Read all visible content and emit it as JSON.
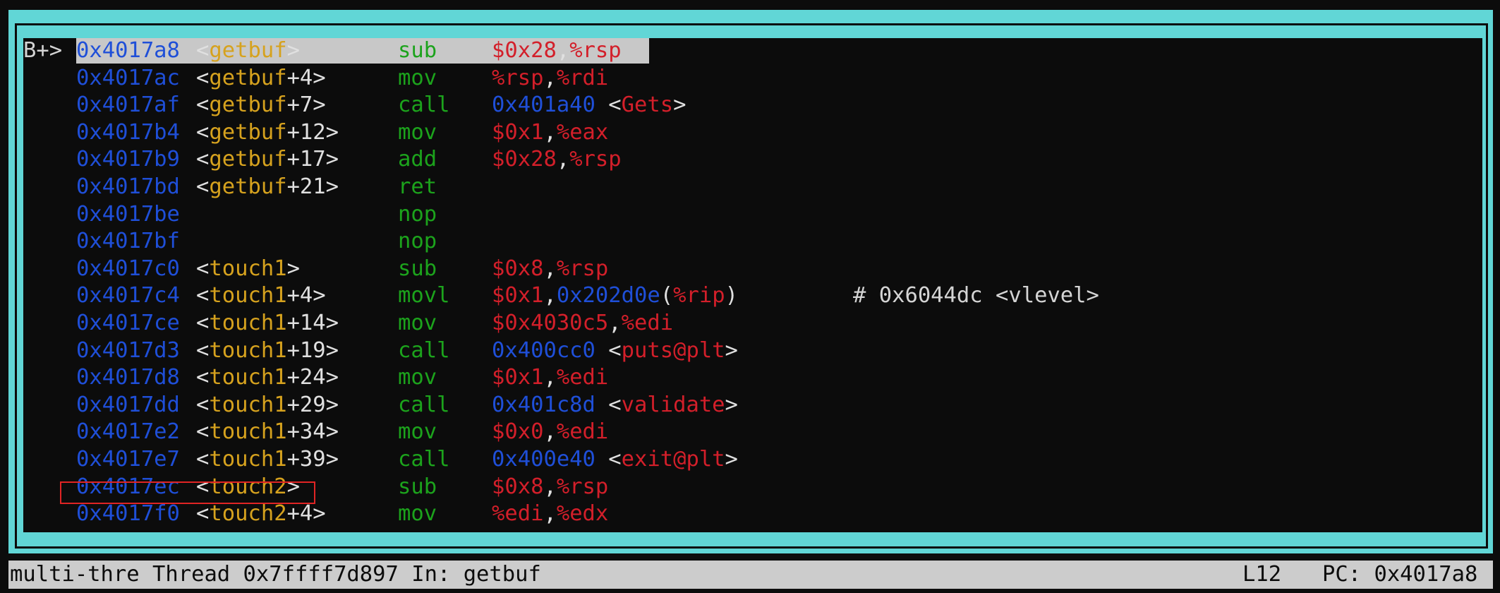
{
  "asm_panel": {
    "rows": [
      {
        "marker": "B+>",
        "addr": "0x4017a8",
        "sym_fn": "getbuf",
        "sym_off": "",
        "mnem": "sub",
        "ops": [
          [
            "$0x28",
            "reg"
          ],
          [
            ",",
            "pun"
          ],
          [
            "%rsp",
            "reg"
          ]
        ],
        "comment": "",
        "current": true
      },
      {
        "marker": "",
        "addr": "0x4017ac",
        "sym_fn": "getbuf",
        "sym_off": "+4",
        "mnem": "mov",
        "ops": [
          [
            "%rsp",
            "reg"
          ],
          [
            ",",
            "pun"
          ],
          [
            "%rdi",
            "reg"
          ]
        ],
        "comment": ""
      },
      {
        "marker": "",
        "addr": "0x4017af",
        "sym_fn": "getbuf",
        "sym_off": "+7",
        "mnem": "call",
        "ops": [
          [
            "0x401a40",
            "hex"
          ],
          [
            " <",
            "pun"
          ],
          [
            "Gets",
            "reg"
          ],
          [
            ">",
            "pun"
          ]
        ],
        "comment": ""
      },
      {
        "marker": "",
        "addr": "0x4017b4",
        "sym_fn": "getbuf",
        "sym_off": "+12",
        "mnem": "mov",
        "ops": [
          [
            "$0x1",
            "reg"
          ],
          [
            ",",
            "pun"
          ],
          [
            "%eax",
            "reg"
          ]
        ],
        "comment": ""
      },
      {
        "marker": "",
        "addr": "0x4017b9",
        "sym_fn": "getbuf",
        "sym_off": "+17",
        "mnem": "add",
        "ops": [
          [
            "$0x28",
            "reg"
          ],
          [
            ",",
            "pun"
          ],
          [
            "%rsp",
            "reg"
          ]
        ],
        "comment": ""
      },
      {
        "marker": "",
        "addr": "0x4017bd",
        "sym_fn": "getbuf",
        "sym_off": "+21",
        "mnem": "ret",
        "ops": [],
        "comment": ""
      },
      {
        "marker": "",
        "addr": "0x4017be",
        "sym_fn": "",
        "sym_off": "",
        "mnem": "nop",
        "ops": [],
        "comment": ""
      },
      {
        "marker": "",
        "addr": "0x4017bf",
        "sym_fn": "",
        "sym_off": "",
        "mnem": "nop",
        "ops": [],
        "comment": ""
      },
      {
        "marker": "",
        "addr": "0x4017c0",
        "sym_fn": "touch1",
        "sym_off": "",
        "mnem": "sub",
        "ops": [
          [
            "$0x8",
            "reg"
          ],
          [
            ",",
            "pun"
          ],
          [
            "%rsp",
            "reg"
          ]
        ],
        "comment": ""
      },
      {
        "marker": "",
        "addr": "0x4017c4",
        "sym_fn": "touch1",
        "sym_off": "+4",
        "mnem": "movl",
        "ops": [
          [
            "$0x1",
            "reg"
          ],
          [
            ",",
            "pun"
          ],
          [
            "0x202d0e",
            "hex"
          ],
          [
            "(",
            "pun"
          ],
          [
            "%rip",
            "reg"
          ],
          [
            ")",
            "pun"
          ]
        ],
        "comment": "# 0x6044dc <vlevel>"
      },
      {
        "marker": "",
        "addr": "0x4017ce",
        "sym_fn": "touch1",
        "sym_off": "+14",
        "mnem": "mov",
        "ops": [
          [
            "$0x4030c5",
            "reg"
          ],
          [
            ",",
            "pun"
          ],
          [
            "%edi",
            "reg"
          ]
        ],
        "comment": ""
      },
      {
        "marker": "",
        "addr": "0x4017d3",
        "sym_fn": "touch1",
        "sym_off": "+19",
        "mnem": "call",
        "ops": [
          [
            "0x400cc0",
            "hex"
          ],
          [
            " <",
            "pun"
          ],
          [
            "puts@plt",
            "reg"
          ],
          [
            ">",
            "pun"
          ]
        ],
        "comment": ""
      },
      {
        "marker": "",
        "addr": "0x4017d8",
        "sym_fn": "touch1",
        "sym_off": "+24",
        "mnem": "mov",
        "ops": [
          [
            "$0x1",
            "reg"
          ],
          [
            ",",
            "pun"
          ],
          [
            "%edi",
            "reg"
          ]
        ],
        "comment": ""
      },
      {
        "marker": "",
        "addr": "0x4017dd",
        "sym_fn": "touch1",
        "sym_off": "+29",
        "mnem": "call",
        "ops": [
          [
            "0x401c8d",
            "hex"
          ],
          [
            " <",
            "pun"
          ],
          [
            "validate",
            "reg"
          ],
          [
            ">",
            "pun"
          ]
        ],
        "comment": ""
      },
      {
        "marker": "",
        "addr": "0x4017e2",
        "sym_fn": "touch1",
        "sym_off": "+34",
        "mnem": "mov",
        "ops": [
          [
            "$0x0",
            "reg"
          ],
          [
            ",",
            "pun"
          ],
          [
            "%edi",
            "reg"
          ]
        ],
        "comment": ""
      },
      {
        "marker": "",
        "addr": "0x4017e7",
        "sym_fn": "touch1",
        "sym_off": "+39",
        "mnem": "call",
        "ops": [
          [
            "0x400e40",
            "hex"
          ],
          [
            " <",
            "pun"
          ],
          [
            "exit@plt",
            "reg"
          ],
          [
            ">",
            "pun"
          ]
        ],
        "comment": ""
      },
      {
        "marker": "",
        "addr": "0x4017ec",
        "sym_fn": "touch2",
        "sym_off": "",
        "mnem": "sub",
        "ops": [
          [
            "$0x8",
            "reg"
          ],
          [
            ",",
            "pun"
          ],
          [
            "%rsp",
            "reg"
          ]
        ],
        "comment": "",
        "boxed": true
      },
      {
        "marker": "",
        "addr": "0x4017f0",
        "sym_fn": "touch2",
        "sym_off": "+4",
        "mnem": "mov",
        "ops": [
          [
            "%edi",
            "reg"
          ],
          [
            ",",
            "pun"
          ],
          [
            "%edx",
            "reg"
          ]
        ],
        "comment": ""
      }
    ]
  },
  "status_bar": {
    "left": "multi-thre Thread 0x7ffff7d897 In: getbuf",
    "line": "L12",
    "pc": "PC: 0x4017a8"
  },
  "colors": {
    "frame": "#61d6d6",
    "background": "#0c0c0c",
    "address": "#1f4fd8",
    "function": "#d6a21e",
    "register": "#d31f2a",
    "mnemonic": "#1ca31c",
    "highlight": "#c8c8c8",
    "annotation_box": "#e02424"
  }
}
